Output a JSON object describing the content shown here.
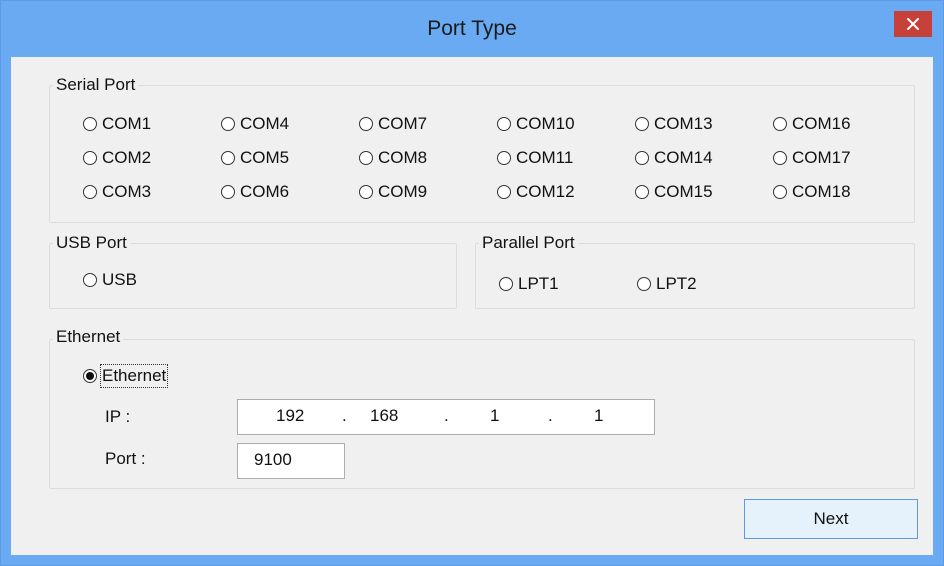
{
  "window": {
    "title": "Port Type"
  },
  "serial": {
    "caption": "Serial Port",
    "ports": [
      "COM1",
      "COM4",
      "COM7",
      "COM10",
      "COM13",
      "COM16",
      "COM2",
      "COM5",
      "COM8",
      "COM11",
      "COM14",
      "COM17",
      "COM3",
      "COM6",
      "COM9",
      "COM12",
      "COM15",
      "COM18"
    ]
  },
  "usb": {
    "caption": "USB Port",
    "option": "USB"
  },
  "parallel": {
    "caption": "Parallel Port",
    "options": [
      "LPT1",
      "LPT2"
    ]
  },
  "ethernet": {
    "caption": "Ethernet",
    "option": "Ethernet",
    "selected": true,
    "ip_label": "IP :",
    "ip": [
      "192",
      "168",
      "1",
      "1"
    ],
    "ip_sep": ".",
    "port_label": "Port :",
    "port": "9100"
  },
  "buttons": {
    "next": "Next"
  },
  "colors": {
    "titlebar": "#6aaaf2",
    "close": "#c7413a",
    "client": "#f0f0f0",
    "button_border": "#5a9ae8"
  }
}
